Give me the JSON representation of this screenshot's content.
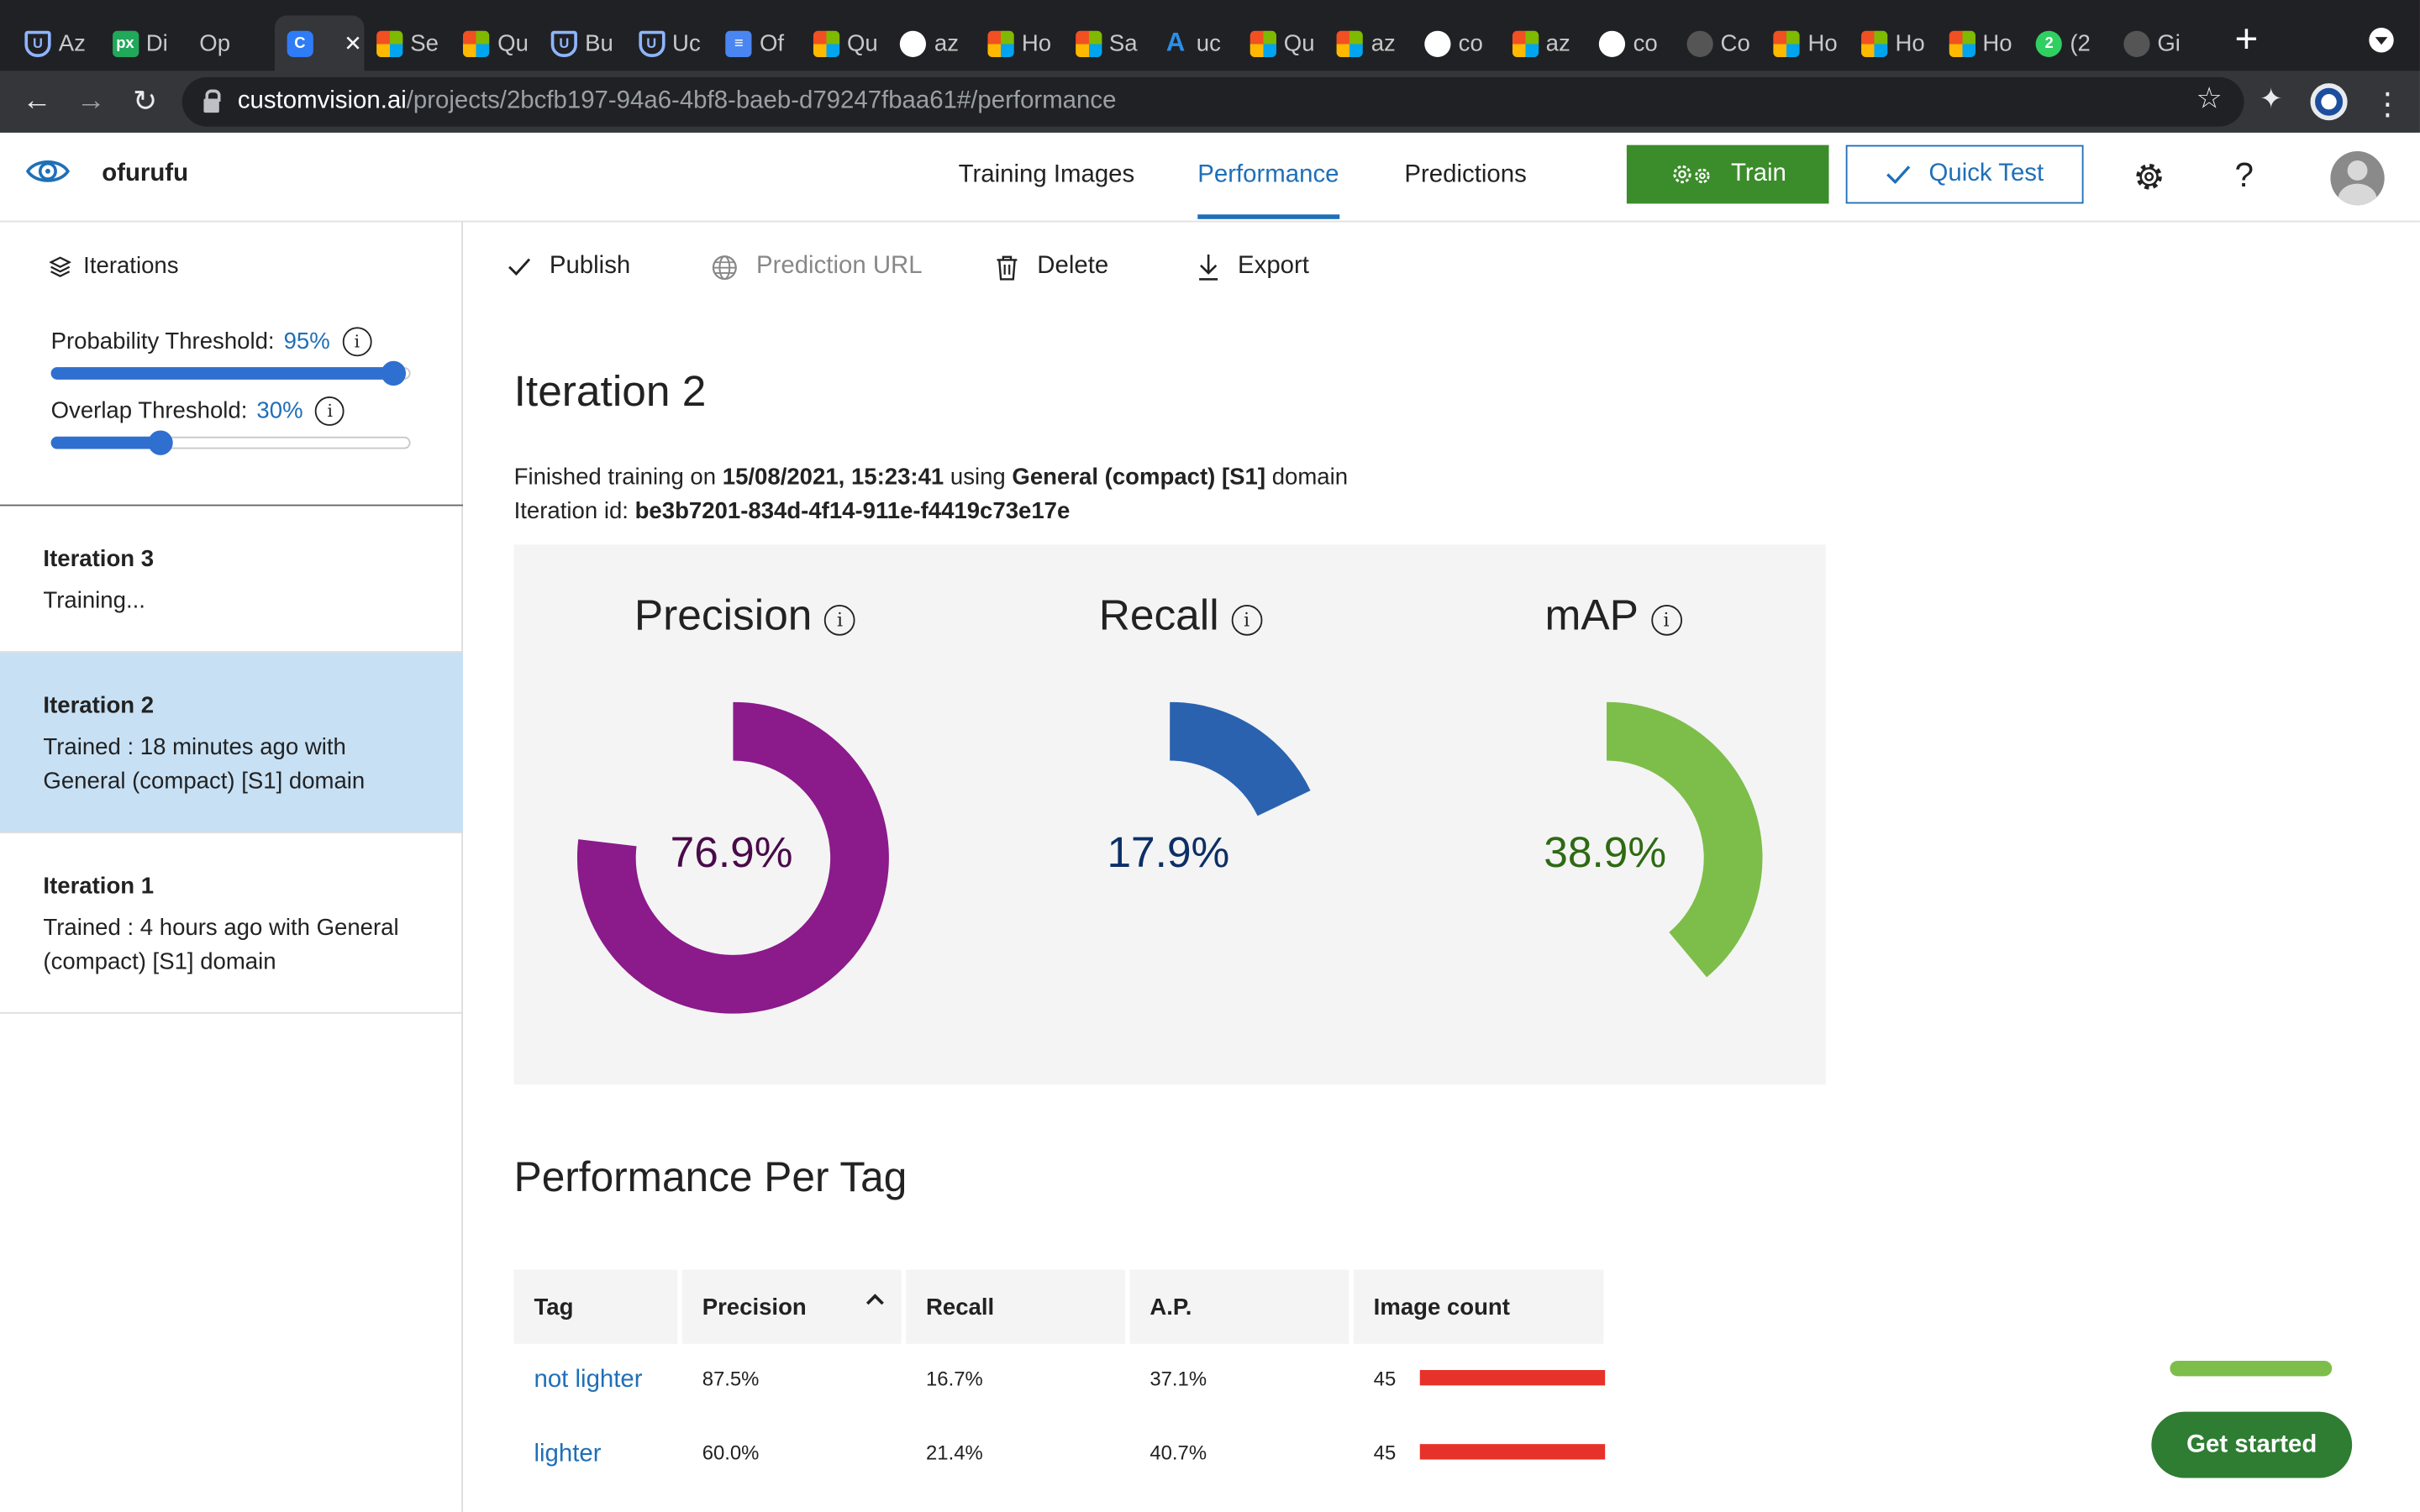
{
  "browser": {
    "tabs": [
      {
        "icon": "udacity",
        "label": "Az"
      },
      {
        "icon": "px",
        "label": "Di"
      },
      {
        "icon": "none",
        "label": "Op"
      },
      {
        "icon": "customvision",
        "label": "",
        "active": true
      },
      {
        "icon": "microsoft",
        "label": "Se"
      },
      {
        "icon": "microsoft",
        "label": "Qu"
      },
      {
        "icon": "udacity",
        "label": "Bu"
      },
      {
        "icon": "udacity",
        "label": "Uc"
      },
      {
        "icon": "docs",
        "label": "Of"
      },
      {
        "icon": "microsoft",
        "label": "Qu"
      },
      {
        "icon": "github",
        "label": "az"
      },
      {
        "icon": "microsoft",
        "label": "Ho"
      },
      {
        "icon": "microsoft",
        "label": "Sa"
      },
      {
        "icon": "azure",
        "label": "uc"
      },
      {
        "icon": "microsoft",
        "label": "Qu"
      },
      {
        "icon": "microsoft",
        "label": "az"
      },
      {
        "icon": "github",
        "label": "co"
      },
      {
        "icon": "microsoft",
        "label": "az"
      },
      {
        "icon": "github",
        "label": "co"
      },
      {
        "icon": "generic",
        "label": "Co"
      },
      {
        "icon": "microsoft",
        "label": "Ho"
      },
      {
        "icon": "microsoft",
        "label": "Ho"
      },
      {
        "icon": "microsoft",
        "label": "Ho"
      },
      {
        "icon": "whatsapp",
        "label": "(2"
      },
      {
        "icon": "github-gray",
        "label": "Gi"
      }
    ],
    "url_host": "customvision.ai",
    "url_path": "/projects/2bcfb197-94a6-4bf8-baeb-d79247fbaa61#/performance"
  },
  "header": {
    "project_name": "ofurufu",
    "nav": {
      "training_images": "Training Images",
      "performance": "Performance",
      "predictions": "Predictions"
    },
    "train_label": "Train",
    "quick_test_label": "Quick Test",
    "help_glyph": "?"
  },
  "sidebar": {
    "iterations_label": "Iterations",
    "probability": {
      "label": "Probability Threshold:",
      "value": "95%",
      "fraction": 0.95
    },
    "overlap": {
      "label": "Overlap Threshold:",
      "value": "30%",
      "fraction": 0.3
    },
    "items": [
      {
        "name": "Iteration 3",
        "status": "Training..."
      },
      {
        "name": "Iteration 2",
        "status": "Trained : 18 minutes ago with General (compact) [S1] domain"
      },
      {
        "name": "Iteration 1",
        "status": "Trained : 4 hours ago with General (compact) [S1] domain"
      }
    ]
  },
  "commands": {
    "publish": "Publish",
    "prediction_url": "Prediction URL",
    "delete": "Delete",
    "export": "Export"
  },
  "iteration": {
    "title": "Iteration 2",
    "finished_prefix": "Finished training on",
    "finished_date": "15/08/2021, 15:23:41",
    "using": "using",
    "domain": "General (compact) [S1]",
    "domain_suffix": "domain",
    "id_label": "Iteration id:",
    "id_value": "be3b7201-834d-4f14-911e-f4419c73e17e"
  },
  "metrics": [
    {
      "name": "Precision",
      "value_text": "76.9%",
      "fraction": 0.769,
      "color": "#8b1a8b",
      "text_color": "#4a0a4a"
    },
    {
      "name": "Recall",
      "value_text": "17.9%",
      "fraction": 0.179,
      "color": "#2a62b0",
      "text_color": "#0c2f66"
    },
    {
      "name": "mAP",
      "value_text": "38.9%",
      "fraction": 0.389,
      "color": "#7dbe4a",
      "text_color": "#2e6a12"
    }
  ],
  "per_tag": {
    "title": "Performance Per Tag",
    "headers": {
      "tag": "Tag",
      "precision": "Precision",
      "recall": "Recall",
      "ap": "A.P.",
      "image_count": "Image count"
    },
    "rows": [
      {
        "tag": "not lighter",
        "precision": "87.5%",
        "recall": "16.7%",
        "ap": "37.1%",
        "image_count": "45"
      },
      {
        "tag": "lighter",
        "precision": "60.0%",
        "recall": "21.4%",
        "ap": "40.7%",
        "image_count": "45"
      }
    ],
    "bar_color": "#e6322a"
  },
  "get_started_label": "Get started",
  "colors": {
    "accent": "#1f6fb8",
    "train_green": "#3b8c2a",
    "selected_bg": "#c7e0f4"
  }
}
